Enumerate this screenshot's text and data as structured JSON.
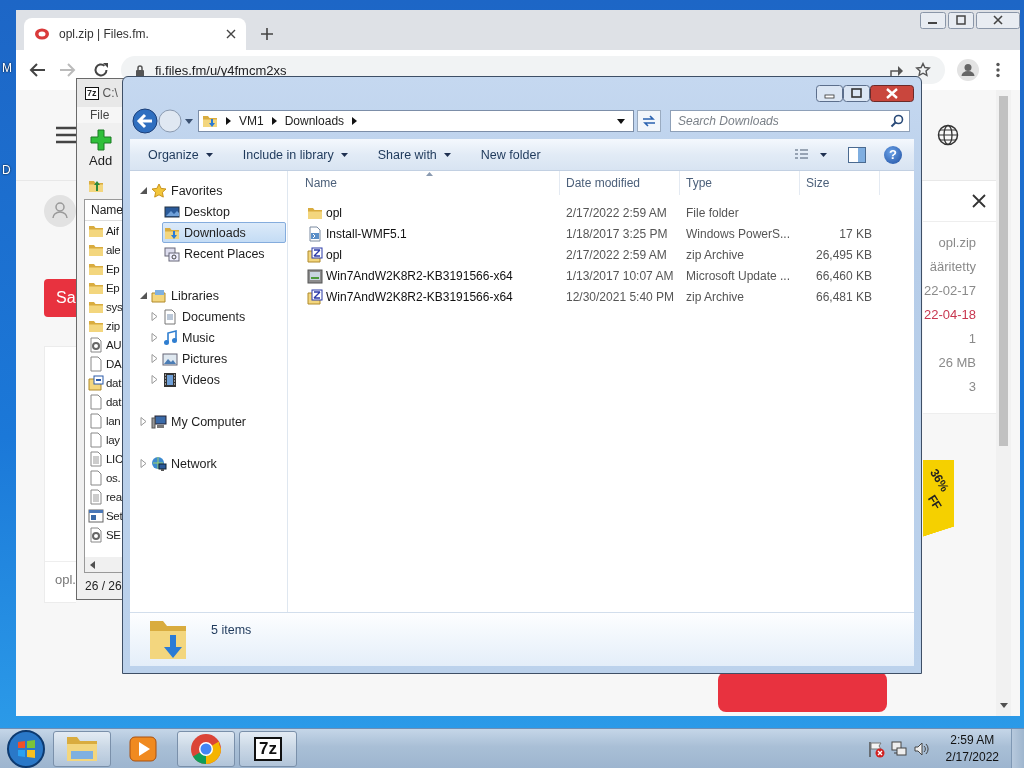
{
  "desktop": {
    "icon_labels": [
      "M",
      "D"
    ]
  },
  "browser": {
    "tabs": [
      {
        "title": "opl.zip | Files.fm.",
        "selected": true
      }
    ],
    "address": "fi.files.fm/u/y4fmcm2xs",
    "page": {
      "left_button": "Sa",
      "card_text": "opl.",
      "details": [
        {
          "value": "opl.zip",
          "color": "#8a8a8a"
        },
        {
          "value": "ääritetty",
          "color": "#8a8a8a"
        },
        {
          "value": "22-02-17",
          "color": "#8a8a8a"
        },
        {
          "value": "22-04-18",
          "color": "#c8364f"
        },
        {
          "value": "1",
          "color": "#8a8a8a"
        },
        {
          "value": "26 MB",
          "color": "#8a8a8a"
        },
        {
          "value": "3",
          "color": "#8a8a8a"
        }
      ],
      "promo": [
        "36%",
        "FF"
      ]
    }
  },
  "archiver": {
    "logo": "7z",
    "title": "C:\\",
    "menu": [
      "File"
    ],
    "toolbar": [
      {
        "label": "Add"
      }
    ],
    "column": "Name",
    "rows": [
      {
        "name": "Aif",
        "kind": "folder"
      },
      {
        "name": "ale",
        "kind": "folder"
      },
      {
        "name": "Ep",
        "kind": "folder"
      },
      {
        "name": "Ep",
        "kind": "folder"
      },
      {
        "name": "sys",
        "kind": "folder"
      },
      {
        "name": "zip",
        "kind": "folder"
      },
      {
        "name": "AU",
        "kind": "config"
      },
      {
        "name": "DA",
        "kind": "file"
      },
      {
        "name": "dat",
        "kind": "catalog"
      },
      {
        "name": "dat",
        "kind": "file"
      },
      {
        "name": "lan",
        "kind": "file"
      },
      {
        "name": "lay",
        "kind": "file"
      },
      {
        "name": "LIC",
        "kind": "text"
      },
      {
        "name": "os.",
        "kind": "file"
      },
      {
        "name": "rea",
        "kind": "text"
      },
      {
        "name": "Set",
        "kind": "app"
      },
      {
        "name": "SE",
        "kind": "config"
      }
    ],
    "status": "26 / 26"
  },
  "explorer": {
    "breadcrumbs": [
      "VM1",
      "Downloads"
    ],
    "search": {
      "placeholder": "Search Downloads"
    },
    "commands": [
      {
        "label": "Organize",
        "menu": true
      },
      {
        "label": "Include in library",
        "menu": true
      },
      {
        "label": "Share with",
        "menu": true
      },
      {
        "label": "New folder",
        "menu": false
      }
    ],
    "help": "?",
    "nav": [
      {
        "label": "Favorites",
        "kind": "favorites",
        "expanded": true,
        "selected": false,
        "children": [
          {
            "label": "Desktop",
            "kind": "desktop",
            "selected": false
          },
          {
            "label": "Downloads",
            "kind": "downloads",
            "selected": true
          },
          {
            "label": "Recent Places",
            "kind": "recent",
            "selected": false
          }
        ]
      },
      {
        "label": "Libraries",
        "kind": "libraries",
        "expanded": true,
        "selected": false,
        "children": [
          {
            "label": "Documents",
            "kind": "documents",
            "expanded": false,
            "selected": false
          },
          {
            "label": "Music",
            "kind": "music",
            "expanded": false,
            "selected": false
          },
          {
            "label": "Pictures",
            "kind": "pictures",
            "expanded": false,
            "selected": false
          },
          {
            "label": "Videos",
            "kind": "videos",
            "expanded": false,
            "selected": false
          }
        ]
      },
      {
        "label": "My Computer",
        "kind": "computer",
        "expanded": false,
        "selected": false
      },
      {
        "label": "Network",
        "kind": "network",
        "expanded": false,
        "selected": false
      }
    ],
    "columns": [
      "Name",
      "Date modified",
      "Type",
      "Size"
    ],
    "rows": [
      {
        "name": "opl",
        "date": "2/17/2022 2:59 AM",
        "type": "File folder",
        "kind": "folder"
      },
      {
        "name": "Install-WMF5.1",
        "date": "1/18/2017 3:25 PM",
        "type": "Windows PowerS...",
        "size": "17 KB",
        "kind": "script"
      },
      {
        "name": "opl",
        "date": "2/17/2022 2:59 AM",
        "type": "zip Archive",
        "size": "26,495 KB",
        "kind": "zip"
      },
      {
        "name": "Win7AndW2K8R2-KB3191566-x64",
        "date": "1/13/2017 10:07 AM",
        "type": "Microsoft Update ...",
        "size": "66,460 KB",
        "kind": "update"
      },
      {
        "name": "Win7AndW2K8R2-KB3191566-x64",
        "date": "12/30/2021 5:40 PM",
        "type": "zip Archive",
        "size": "66,481 KB",
        "kind": "zip"
      }
    ],
    "status": "5 items"
  },
  "taskbar": {
    "apps": [
      {
        "kind": "explorer",
        "running": true
      },
      {
        "kind": "media",
        "running": false
      },
      {
        "kind": "chrome",
        "running": true
      },
      {
        "kind": "archiver",
        "running": true,
        "label": "7z"
      }
    ],
    "clock": {
      "time": "2:59 AM",
      "date": "2/17/2022"
    }
  }
}
